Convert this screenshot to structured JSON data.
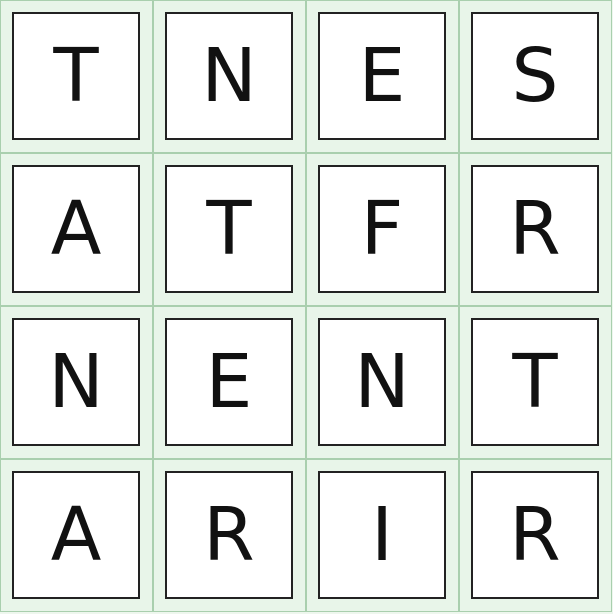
{
  "grid": {
    "rows": 4,
    "cols": 4,
    "letters": [
      [
        "T",
        "N",
        "E",
        "S"
      ],
      [
        "A",
        "T",
        "F",
        "R"
      ],
      [
        "N",
        "E",
        "N",
        "T"
      ],
      [
        "A",
        "R",
        "I",
        "R"
      ]
    ]
  },
  "colors": {
    "cell_background": "#e8f5e9",
    "cell_border": "#a9cfae",
    "tile_background": "#ffffff",
    "tile_border": "#222222",
    "letter": "#111111"
  }
}
